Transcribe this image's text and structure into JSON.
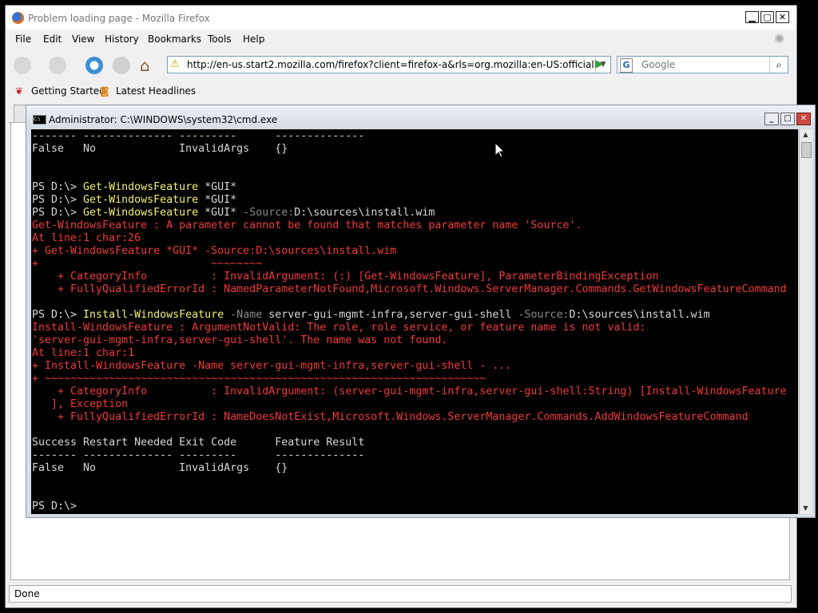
{
  "firefox": {
    "title": "Problem loading page - Mozilla Firefox",
    "window_buttons": {
      "minimize": "▁",
      "maximize": "▢",
      "close": "✕"
    },
    "menu": [
      "File",
      "Edit",
      "View",
      "History",
      "Bookmarks",
      "Tools",
      "Help"
    ],
    "url": "http://en-us.start2.mozilla.com/firefox?client=firefox-a&rls=org.mozilla:en-US:official",
    "search_engine": "G",
    "search_placeholder": "Google",
    "bookmarks": [
      "Getting Started",
      "Latest Headlines"
    ],
    "status": "Done"
  },
  "cmd": {
    "title": "Administrator: C:\\WINDOWS\\system32\\cmd.exe",
    "icon_text": "C:\\",
    "lines": [
      [
        {
          "c": "w",
          "t": "------- -------------- ---------      --------------"
        }
      ],
      [
        {
          "c": "w",
          "t": "False   No             InvalidArgs    {}"
        }
      ],
      [
        {
          "c": "w",
          "t": ""
        }
      ],
      [
        {
          "c": "w",
          "t": ""
        }
      ],
      [
        {
          "c": "w",
          "t": "PS D:\\> "
        },
        {
          "c": "y",
          "t": "Get-WindowsFeature"
        },
        {
          "c": "w",
          "t": " *GUI*"
        }
      ],
      [
        {
          "c": "w",
          "t": "PS D:\\> "
        },
        {
          "c": "y",
          "t": "Get-WindowsFeature"
        },
        {
          "c": "w",
          "t": " *GUI*"
        }
      ],
      [
        {
          "c": "w",
          "t": "PS D:\\> "
        },
        {
          "c": "y",
          "t": "Get-WindowsFeature"
        },
        {
          "c": "w",
          "t": " *GUI* "
        },
        {
          "c": "g",
          "t": "-Source:"
        },
        {
          "c": "w",
          "t": "D:\\sources\\install.wim"
        }
      ],
      [
        {
          "c": "r",
          "t": "Get-WindowsFeature : A parameter cannot be found that matches parameter name 'Source'."
        }
      ],
      [
        {
          "c": "r",
          "t": "At line:1 char:26"
        }
      ],
      [
        {
          "c": "r",
          "t": "+ Get-WindowsFeature *GUI* -Source:D:\\sources\\install.wim"
        }
      ],
      [
        {
          "c": "r",
          "t": "+                           ~~~~~~~~"
        }
      ],
      [
        {
          "c": "r",
          "t": "    + CategoryInfo          : InvalidArgument: (:) [Get-WindowsFeature], ParameterBindingException"
        }
      ],
      [
        {
          "c": "r",
          "t": "    + FullyQualifiedErrorId : NamedParameterNotFound,Microsoft.Windows.ServerManager.Commands.GetWindowsFeatureCommand"
        }
      ],
      [
        {
          "c": "w",
          "t": ""
        }
      ],
      [
        {
          "c": "w",
          "t": "PS D:\\> "
        },
        {
          "c": "y",
          "t": "Install-WindowsFeature"
        },
        {
          "c": "g",
          "t": " -Name "
        },
        {
          "c": "w",
          "t": "server-gui-mgmt-infra,server-gui-shell "
        },
        {
          "c": "g",
          "t": "-Source:"
        },
        {
          "c": "w",
          "t": "D:\\sources\\install.wim"
        }
      ],
      [
        {
          "c": "r",
          "t": "Install-WindowsFeature : ArgumentNotValid: The role, role service, or feature name is not valid:"
        }
      ],
      [
        {
          "c": "r",
          "t": "'server-gui-mgmt-infra,server-gui-shell'. The name was not found."
        }
      ],
      [
        {
          "c": "r",
          "t": "At line:1 char:1"
        }
      ],
      [
        {
          "c": "r",
          "t": "+ Install-WindowsFeature -Name server-gui-mgmt-infra,server-gui-shell - ..."
        }
      ],
      [
        {
          "c": "r",
          "t": "+ ~~~~~~~~~~~~~~~~~~~~~~~~~~~~~~~~~~~~~~~~~~~~~~~~~~~~~~~~~~~~~~~~~~~~~"
        }
      ],
      [
        {
          "c": "r",
          "t": "    + CategoryInfo          : InvalidArgument: (server-gui-mgmt-infra,server-gui-shell:String) [Install-WindowsFeature"
        }
      ],
      [
        {
          "c": "r",
          "t": "   ], Exception"
        }
      ],
      [
        {
          "c": "r",
          "t": "    + FullyQualifiedErrorId : NameDoesNotExist,Microsoft.Windows.ServerManager.Commands.AddWindowsFeatureCommand"
        }
      ],
      [
        {
          "c": "w",
          "t": ""
        }
      ],
      [
        {
          "c": "w",
          "t": "Success Restart Needed Exit Code      Feature Result"
        }
      ],
      [
        {
          "c": "w",
          "t": "------- -------------- ---------      --------------"
        }
      ],
      [
        {
          "c": "w",
          "t": "False   No             InvalidArgs    {}"
        }
      ],
      [
        {
          "c": "w",
          "t": ""
        }
      ],
      [
        {
          "c": "w",
          "t": ""
        }
      ],
      [
        {
          "c": "w",
          "t": "PS D:\\>"
        }
      ]
    ]
  }
}
